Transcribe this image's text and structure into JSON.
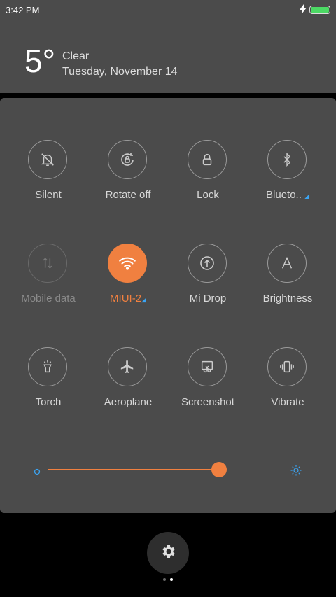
{
  "status": {
    "time": "3:42 PM",
    "battery_level": 1.0
  },
  "weather": {
    "temp": "5°",
    "condition": "Clear",
    "date": "Tuesday, November 14"
  },
  "tiles": [
    {
      "label": "Silent",
      "icon": "bell-off-icon"
    },
    {
      "label": "Rotate off",
      "icon": "rotate-lock-icon"
    },
    {
      "label": "Lock",
      "icon": "lock-icon"
    },
    {
      "label": "Blueto..",
      "icon": "bluetooth-icon"
    },
    {
      "label": "Mobile data",
      "icon": "mobile-data-icon"
    },
    {
      "label": "MIUI-2",
      "icon": "wifi-icon"
    },
    {
      "label": "Mi Drop",
      "icon": "upload-icon"
    },
    {
      "label": "Brightness",
      "icon": "brightness-auto-icon"
    },
    {
      "label": "Torch",
      "icon": "torch-icon"
    },
    {
      "label": "Aeroplane",
      "icon": "airplane-icon"
    },
    {
      "label": "Screenshot",
      "icon": "screenshot-icon"
    },
    {
      "label": "Vibrate",
      "icon": "vibrate-icon"
    }
  ],
  "brightness": {
    "level": 0.95
  },
  "colors": {
    "accent": "#f08040",
    "panel": "#4b4b4b",
    "link": "#3ba4f2"
  }
}
